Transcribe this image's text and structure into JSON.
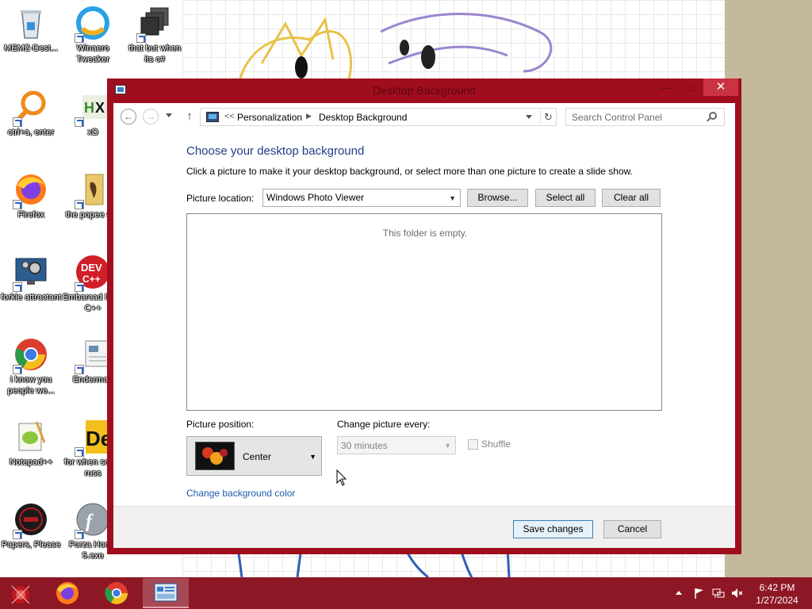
{
  "desktop": {
    "icons": [
      {
        "label": "MEMZ-Dest...",
        "icon": "recycle-bin-icon"
      },
      {
        "label": "Winaero Tweaker",
        "icon": "winaero-icon"
      },
      {
        "label": "that but when its c#",
        "icon": "stacked-windows-icon"
      },
      {
        "label": "ctrl+a, enter",
        "icon": "orange-magnifier-icon"
      },
      {
        "label": "xD",
        "icon": "hxd-icon"
      },
      {
        "label": "Firefox",
        "icon": "firefox-icon"
      },
      {
        "label": "the popee shit",
        "icon": "folder-icon"
      },
      {
        "label": "forkie attractant",
        "icon": "monitor-gear-icon"
      },
      {
        "label": "Embarcad Dev-C++",
        "icon": "devcpp-icon"
      },
      {
        "label": "i know you people we...",
        "icon": "chrome-icon"
      },
      {
        "label": "Enderman",
        "icon": "document-window-icon"
      },
      {
        "label": "Notepad++",
        "icon": "notepadpp-icon"
      },
      {
        "label": "for when some russ",
        "icon": "de-logo-icon"
      },
      {
        "label": "Papers, Please",
        "icon": "papers-please-icon"
      },
      {
        "label": "Forza Hori... 5.exe",
        "icon": "flash-icon"
      }
    ]
  },
  "window": {
    "title": "Desktop Background",
    "controls": {
      "minimize": "—",
      "maximize": "□",
      "close": "✕"
    }
  },
  "address": {
    "overflow": "<<",
    "crumbs": [
      "Personalization",
      "Desktop Background"
    ],
    "search_placeholder": "Search Control Panel"
  },
  "content": {
    "heading": "Choose your desktop background",
    "description": "Click a picture to make it your desktop background, or select more than one picture to create a slide show.",
    "picture_location_label": "Picture location:",
    "picture_location_value": "Windows Photo Viewer",
    "browse_label": "Browse...",
    "select_all_label": "Select all",
    "clear_all_label": "Clear all",
    "empty_message": "This folder is empty.",
    "picture_position_label": "Picture position:",
    "picture_position_value": "Center",
    "change_every_label": "Change picture every:",
    "change_every_value": "30 minutes",
    "shuffle_label": "Shuffle",
    "shuffle_checked": false,
    "change_color_link": "Change background color"
  },
  "footer": {
    "save_label": "Save changes",
    "cancel_label": "Cancel"
  },
  "taskbar": {
    "apps": [
      "firefox-icon",
      "chrome-icon",
      "control-panel-icon"
    ],
    "active_app": "control-panel-icon",
    "time": "6:42 PM",
    "date": "1/27/2024"
  },
  "colors": {
    "window_frame": "#a00e1e",
    "taskbar": "#8e1725",
    "heading": "#1e3f87",
    "link": "#1d5bab",
    "close_button": "#c93343"
  }
}
